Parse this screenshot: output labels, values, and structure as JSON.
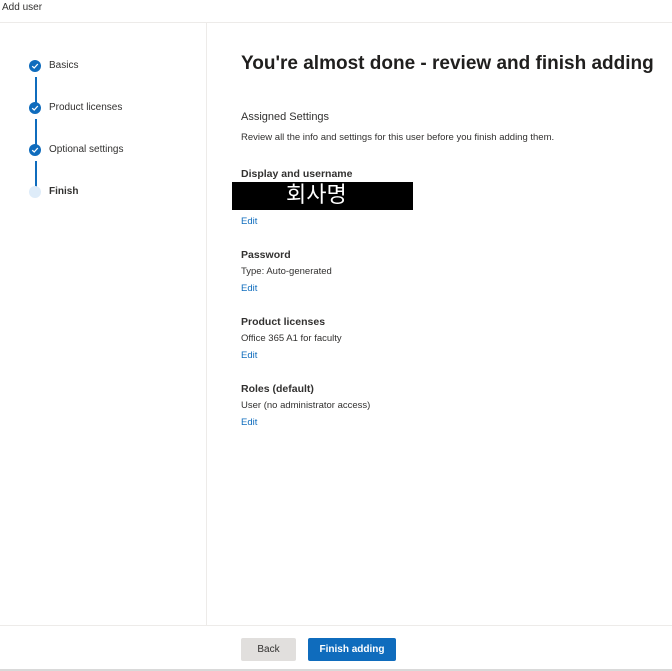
{
  "window": {
    "title": "Add user"
  },
  "steps": [
    {
      "label": "Basics",
      "status": "complete"
    },
    {
      "label": "Product licenses",
      "status": "complete"
    },
    {
      "label": "Optional settings",
      "status": "complete"
    },
    {
      "label": "Finish",
      "status": "current"
    }
  ],
  "main": {
    "heading": "You're almost done - review and finish adding",
    "assigned_title": "Assigned Settings",
    "assigned_desc": "Review all the info and settings for this user before you finish adding them.",
    "sections": {
      "display": {
        "title": "Display and username",
        "value": "회사명",
        "edit": "Edit"
      },
      "password": {
        "title": "Password",
        "value": "Type: Auto-generated",
        "edit": "Edit"
      },
      "licenses": {
        "title": "Product licenses",
        "value": "Office 365 A1 for faculty",
        "edit": "Edit"
      },
      "roles": {
        "title": "Roles (default)",
        "value": "User (no administrator access)",
        "edit": "Edit"
      }
    }
  },
  "footer": {
    "back_label": "Back",
    "finish_label": "Finish adding"
  },
  "colors": {
    "accent": "#0f6cbd",
    "pending_step": "#deecf9",
    "secondary_button": "#e1dfdd"
  }
}
